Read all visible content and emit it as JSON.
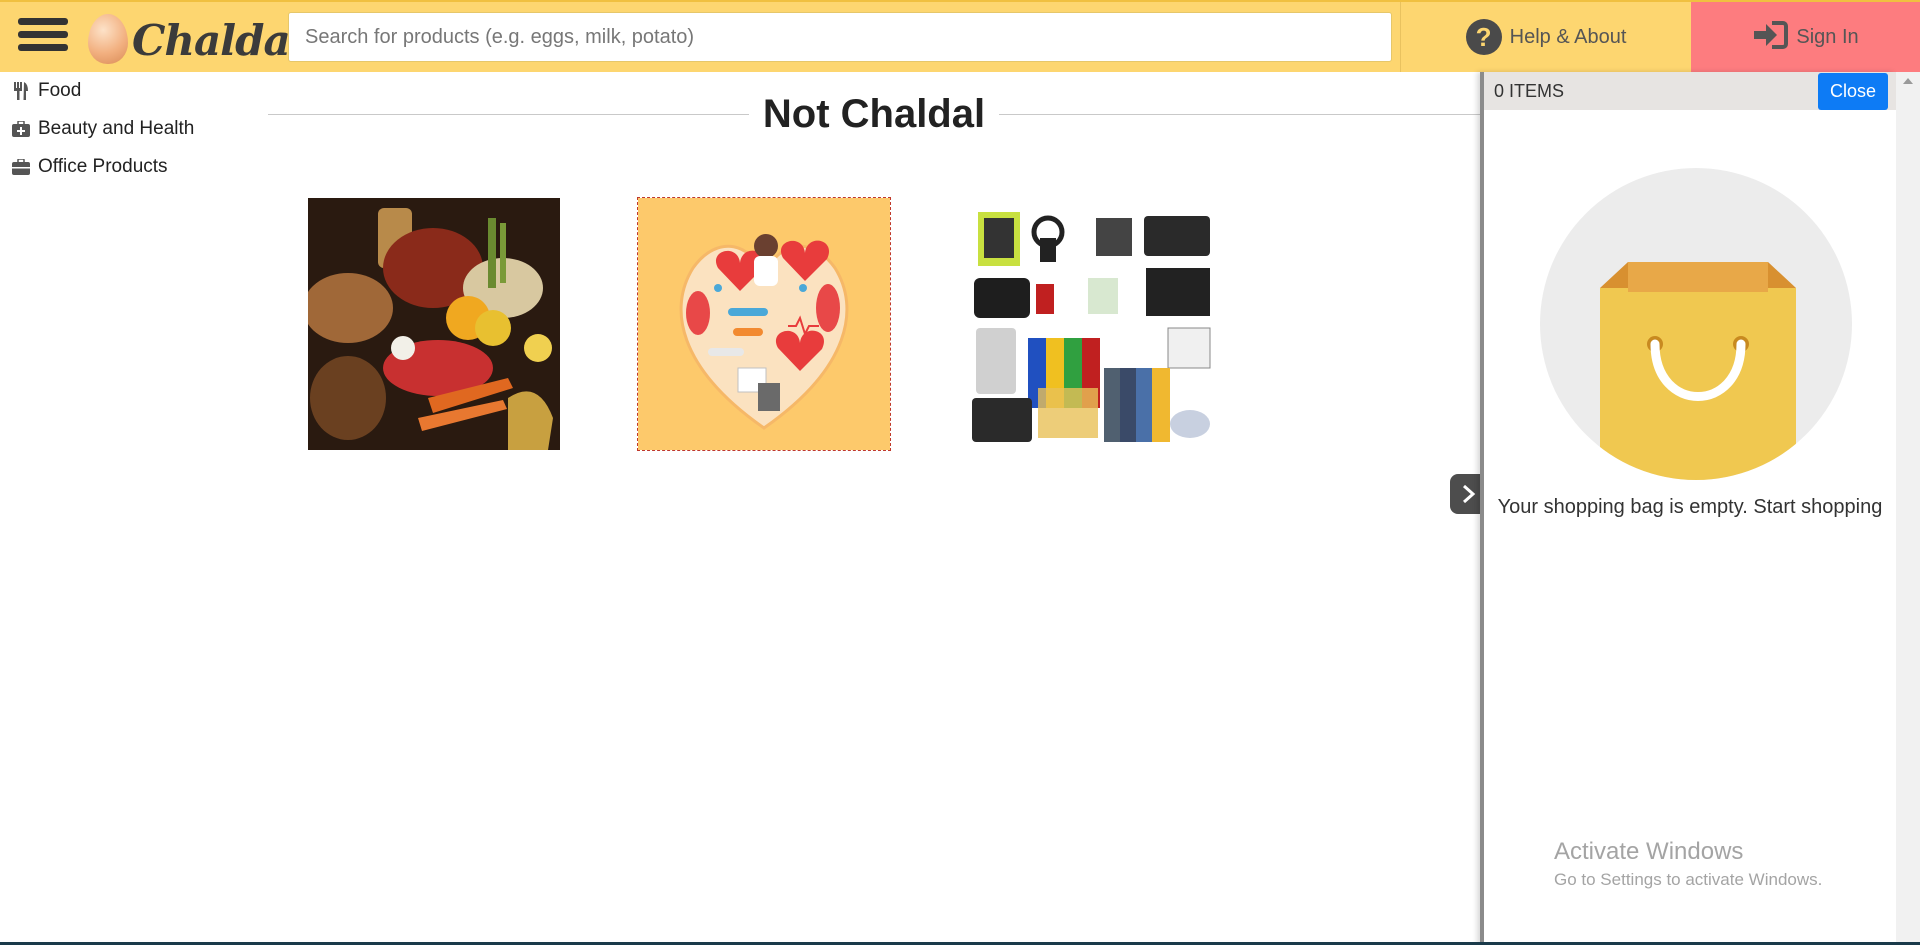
{
  "header": {
    "logo_text": "Chaldal",
    "search_placeholder": "Search for products (e.g. eggs, milk, potato)",
    "help_label": "Help & About",
    "signin_label": "Sign In"
  },
  "sidebar": {
    "items": [
      {
        "label": "Food",
        "icon": "utensils-icon"
      },
      {
        "label": "Beauty and Health",
        "icon": "medkit-icon"
      },
      {
        "label": "Office Products",
        "icon": "briefcase-icon"
      }
    ]
  },
  "main": {
    "title": "Not Chaldal",
    "tiles": [
      {
        "name": "food-category-tile"
      },
      {
        "name": "beauty-health-category-tile"
      },
      {
        "name": "office-products-category-tile"
      }
    ]
  },
  "cart": {
    "count_label": "0 ITEMS",
    "close_label": "Close",
    "empty_message": "Your shopping bag is empty. Start shopping"
  },
  "watermark": {
    "title": "Activate Windows",
    "subtitle": "Go to Settings to activate Windows."
  },
  "colors": {
    "header_bg": "#fdd670",
    "signin_bg": "#fd7c7f",
    "close_btn": "#0d7bf5"
  }
}
